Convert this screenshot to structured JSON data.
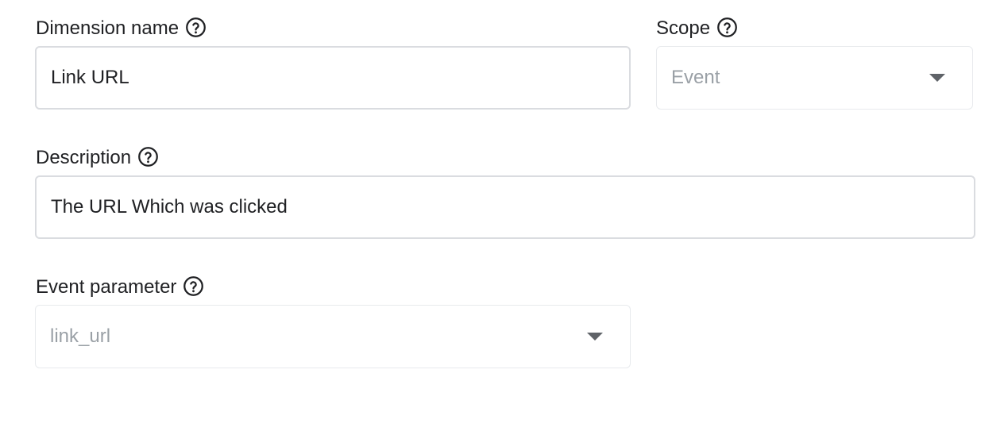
{
  "dimension_name": {
    "label": "Dimension name",
    "value": "Link URL",
    "help_icon": "help-circle-icon"
  },
  "scope": {
    "label": "Scope",
    "selected": "Event",
    "help_icon": "help-circle-icon"
  },
  "description": {
    "label": "Description",
    "value": "The URL Which was clicked",
    "help_icon": "help-circle-icon"
  },
  "event_parameter": {
    "label": "Event parameter",
    "selected": "link_url",
    "help_icon": "help-circle-icon"
  },
  "colors": {
    "text": "#202124",
    "placeholder": "#9aa0a6",
    "border": "#dadce0",
    "caret": "#5f6368"
  }
}
